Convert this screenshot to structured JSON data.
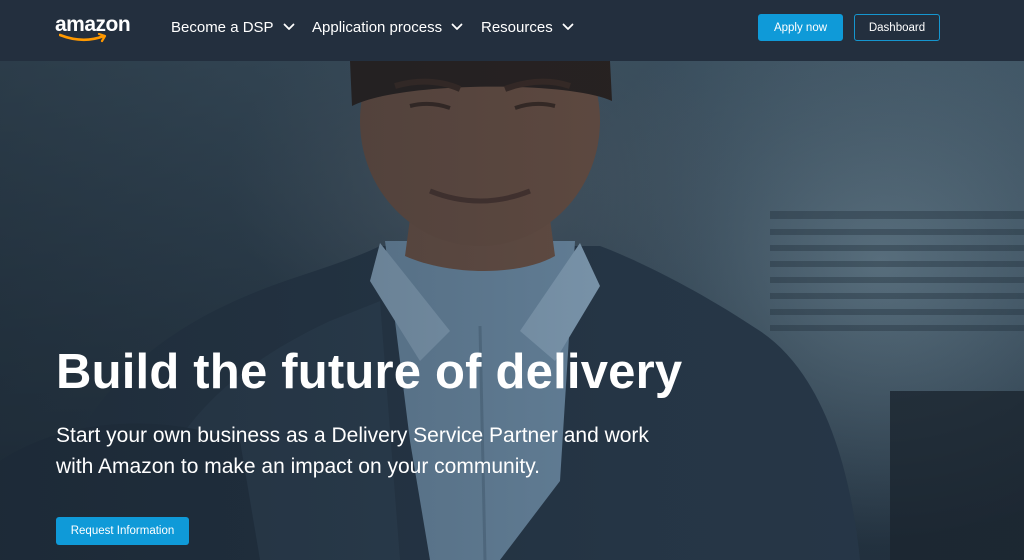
{
  "brand": {
    "logo_text": "amazon",
    "accent_color": "#0f9ad8",
    "nav_background": "#232f3e"
  },
  "nav": {
    "items": [
      {
        "label": "Become a DSP",
        "icon": "chevron-down-icon"
      },
      {
        "label": "Application process",
        "icon": "chevron-down-icon"
      },
      {
        "label": "Resources",
        "icon": "chevron-down-icon"
      }
    ],
    "apply_label": "Apply now",
    "dashboard_label": "Dashboard"
  },
  "hero": {
    "title": "Build the future of delivery",
    "subtitle": "Start your own business as a Delivery Service Partner and work with Amazon to make an impact on your community.",
    "cta_label": "Request Information",
    "image": "delivery-partner-photo"
  }
}
